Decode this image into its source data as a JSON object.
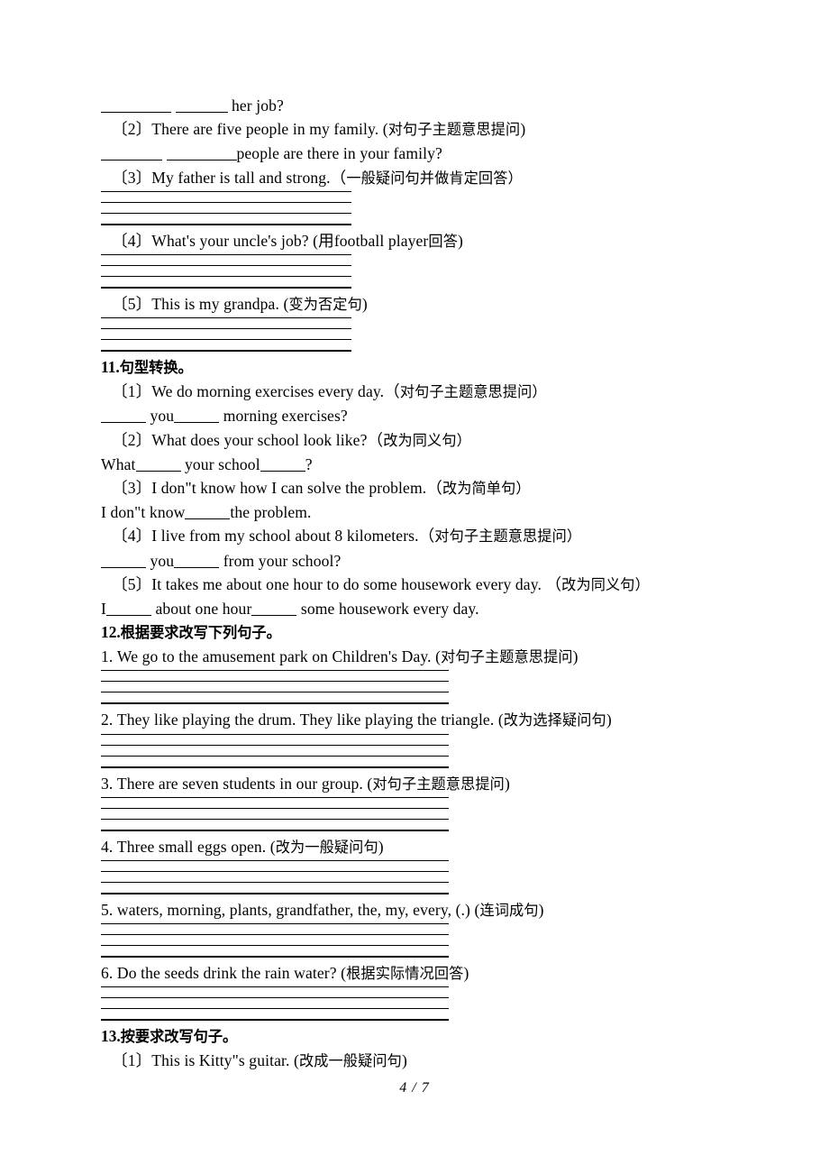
{
  "document": {
    "footer": "4 / 7"
  },
  "carryover": {
    "q1_answer_line": "her job?",
    "items": [
      {
        "num": "〔2〕",
        "text": "There are five people in my family. (",
        "cn": "对句子主题意思提问",
        "close": ")",
        "answer_tail": "people are there in your family?"
      },
      {
        "num": "〔3〕",
        "text": "My father is tall and strong.（",
        "cn": "一般疑问句并做肯定回答",
        "close": "）"
      },
      {
        "num": "〔4〕",
        "text": "What's your uncle's job? (用football player",
        "cn": "回答",
        "close": ")"
      },
      {
        "num": "〔5〕",
        "text": "This is my grandpa. (",
        "cn": "变为否定句",
        "close": ")"
      }
    ]
  },
  "section11": {
    "number": "11.",
    "title": "句型转换。",
    "items": [
      {
        "num": "〔1〕",
        "text": "We do morning exercises every day.（",
        "cn": "对句子主题意思提问",
        "close": "）",
        "answer_mid": "you",
        "answer_tail": "morning exercises?"
      },
      {
        "num": "〔2〕",
        "text": "What does your school look like?（",
        "cn": "改为同义句",
        "close": "）",
        "answer_head": "What",
        "answer_mid": "your school",
        "answer_tail": "?"
      },
      {
        "num": "〔3〕",
        "text": "I don\"t know how I can solve the problem.（",
        "cn": "改为简单句",
        "close": "）",
        "answer_head": "I don\"t know",
        "answer_tail": "the problem."
      },
      {
        "num": "〔4〕",
        "text": "I live from my school about 8 kilometers.（",
        "cn": "对句子主题意思提问",
        "close": "）",
        "answer_mid": "you",
        "answer_tail": "from your school?"
      },
      {
        "num": "〔5〕",
        "text": "It takes me about one hour to do some housework every day. （",
        "cn": "改为同义句",
        "close": "）",
        "answer_head": "I",
        "answer_mid": "about one hour",
        "answer_tail": "some housework every day."
      }
    ]
  },
  "section12": {
    "number": "12.",
    "title": "根据要求改写下列句子。",
    "items": [
      {
        "num": "1.",
        "text": "We go to the amusement park on Children's Day. (",
        "cn": "对句子主题意思提问",
        "close": ")"
      },
      {
        "num": "2.",
        "text": "They like playing the drum. They like playing the triangle. (",
        "cn": "改为选择疑问句",
        "close": ")"
      },
      {
        "num": "3.",
        "text": "There are seven students in our group. (",
        "cn": "对句子主题意思提问",
        "close": ")"
      },
      {
        "num": "4.",
        "text": "Three small eggs open. (",
        "cn": "改为一般疑问句",
        "close": ")"
      },
      {
        "num": "5.",
        "text": "waters, morning, plants, grandfather, the, my, every, (.) (",
        "cn": "连词成句",
        "close": ")"
      },
      {
        "num": "6.",
        "text": "Do the seeds drink the rain water? (",
        "cn": "根据实际情况回答",
        "close": ")"
      }
    ]
  },
  "section13": {
    "number": "13.",
    "title": "按要求改写句子。",
    "items": [
      {
        "num": "〔1〕",
        "text": "This is Kitty\"s guitar. (",
        "cn": "改成一般疑问句",
        "close": ")"
      }
    ]
  }
}
